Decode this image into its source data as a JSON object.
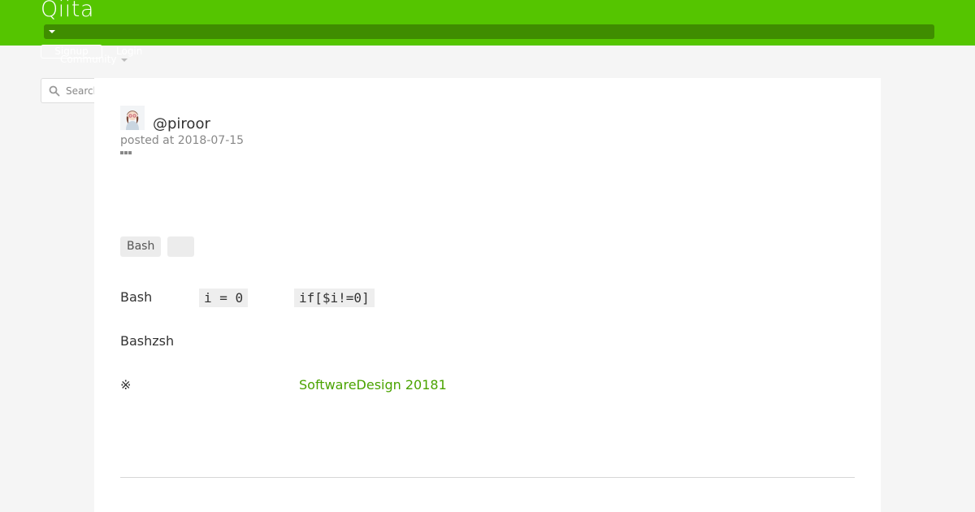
{
  "header": {
    "logo": "Qiita",
    "signup_label": "Signup",
    "login_label": "Login",
    "community_label": "Community",
    "brand_color": "#55c500",
    "menu_bar_color": "#3f8d00"
  },
  "search": {
    "placeholder": "Search"
  },
  "article": {
    "author": "@piroor",
    "posted": "posted at 2018-07-15",
    "tags": [
      "Bash",
      ""
    ],
    "line1": "Bash",
    "code1": "i = 0",
    "code2": "if[$i!=0]",
    "line2": "Bashzsh",
    "note_mark": "※",
    "link_text": "SoftwareDesign 20181",
    "link_color": "#4aa300"
  }
}
